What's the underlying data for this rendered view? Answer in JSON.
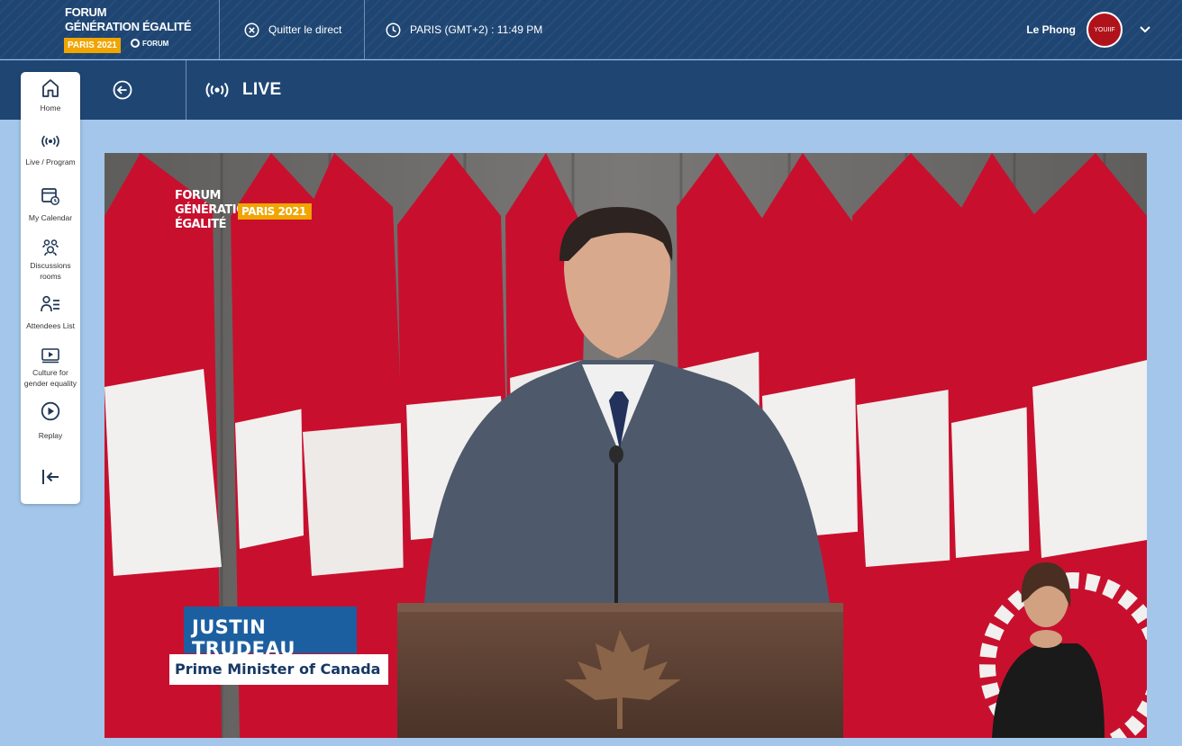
{
  "brand": {
    "line1": "FORUM",
    "line2": "GÉNÉRATION ÉGALITÉ",
    "badge": "PARIS 2021",
    "secondary_logo": "FORUM"
  },
  "topbar": {
    "quit_label": "Quitter le direct",
    "clock_label": "PARIS (GMT+2) : 11:49 PM",
    "user_name": "Le Phong",
    "avatar_text": "YOUIIF"
  },
  "page": {
    "title": "LIVE"
  },
  "sidebar": {
    "items": [
      {
        "label": "Home",
        "icon": "home-icon"
      },
      {
        "label": "Live / Program",
        "icon": "broadcast-icon"
      },
      {
        "label": "My Calendar",
        "icon": "calendar-icon"
      },
      {
        "label": "Discussions rooms",
        "icon": "discussion-icon"
      },
      {
        "label": "Attendees List",
        "icon": "attendees-icon"
      },
      {
        "label": "Culture for gender equality",
        "icon": "video-icon"
      },
      {
        "label": "Replay",
        "icon": "play-icon"
      },
      {
        "label": "",
        "icon": "logout-icon"
      }
    ]
  },
  "video": {
    "logo_line1": "FORUM",
    "logo_line2": "GÉNÉRATION",
    "logo_line3": "ÉGALITÉ",
    "logo_badge": "PARIS 2021",
    "speaker_name": "JUSTIN TRUDEAU",
    "speaker_role": "Prime Minister of Canada"
  },
  "colors": {
    "header": "#1f4673",
    "background": "#a3c6ea",
    "accent": "#f0a500",
    "flag_red": "#c8102e"
  }
}
